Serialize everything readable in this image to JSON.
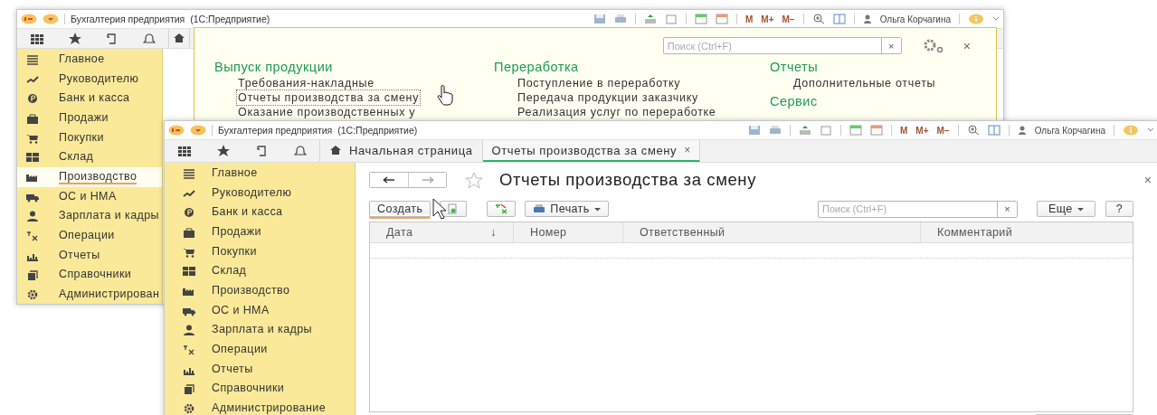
{
  "back_window": {
    "title": "Бухгалтерия предприятия",
    "app": "(1С:Предприятие)",
    "memory": [
      "M",
      "M+",
      "M−"
    ],
    "user": "Ольга Корчагина",
    "sidebar": [
      {
        "label": "Главное",
        "selected": false
      },
      {
        "label": "Руководителю",
        "selected": false
      },
      {
        "label": "Банк и касса",
        "selected": false
      },
      {
        "label": "Продажи",
        "selected": false
      },
      {
        "label": "Покупки",
        "selected": false
      },
      {
        "label": "Склад",
        "selected": false
      },
      {
        "label": "Производство",
        "selected": true
      },
      {
        "label": "ОС и НМА",
        "selected": false
      },
      {
        "label": "Зарплата и кадры",
        "selected": false
      },
      {
        "label": "Операции",
        "selected": false
      },
      {
        "label": "Отчеты",
        "selected": false
      },
      {
        "label": "Справочники",
        "selected": false
      },
      {
        "label": "Администрирован",
        "selected": false
      }
    ],
    "menu_panel": {
      "search": {
        "placeholder": "Поиск (Ctrl+F)"
      },
      "clear": "×",
      "close": "×",
      "columns": [
        {
          "sections": [
            {
              "title": "Выпуск продукции",
              "items": [
                {
                  "label": "Требования-накладные",
                  "focused": false
                },
                {
                  "label": "Отчеты производства за смену",
                  "focused": true
                },
                {
                  "label": "Оказание производственных у",
                  "focused": false
                }
              ]
            }
          ]
        },
        {
          "sections": [
            {
              "title": "Переработка",
              "items": [
                {
                  "label": "Поступление в переработку",
                  "focused": false
                },
                {
                  "label": "Передача продукции заказчику",
                  "focused": false
                },
                {
                  "label": "Реализация услуг по переработке",
                  "focused": false
                }
              ]
            }
          ]
        },
        {
          "sections": [
            {
              "title": "Отчеты",
              "items": [
                {
                  "label": "Дополнительные отчеты",
                  "focused": false
                }
              ]
            },
            {
              "title": "Сервис"
            }
          ]
        }
      ]
    }
  },
  "front_window": {
    "title": "Бухгалтерия предприятия",
    "app": "(1С:Предприятие)",
    "memory": [
      "M",
      "M+",
      "M−"
    ],
    "user": "Ольга Корчагина",
    "tabs": [
      {
        "kind": "home",
        "label": "Начальная страница",
        "selected": false
      },
      {
        "kind": "document",
        "label": "Отчеты производства за смену",
        "close": "×",
        "selected": true
      }
    ],
    "sidebar": [
      {
        "label": "Главное",
        "selected": false
      },
      {
        "label": "Руководителю",
        "selected": false
      },
      {
        "label": "Банк и касса",
        "selected": false
      },
      {
        "label": "Продажи",
        "selected": false
      },
      {
        "label": "Покупки",
        "selected": false
      },
      {
        "label": "Склад",
        "selected": false
      },
      {
        "label": "Производство",
        "selected": false
      },
      {
        "label": "ОС и НМА",
        "selected": false
      },
      {
        "label": "Зарплата и кадры",
        "selected": false
      },
      {
        "label": "Операции",
        "selected": false
      },
      {
        "label": "Отчеты",
        "selected": false
      },
      {
        "label": "Справочники",
        "selected": false
      },
      {
        "label": "Администрирование",
        "selected": false
      }
    ],
    "form": {
      "title": "Отчеты производства за смену",
      "close": "×",
      "create": "Создать",
      "print": "Печать",
      "search": {
        "placeholder": "Поиск (Ctrl+F)"
      },
      "clear": "×",
      "more": "Еще",
      "help": "?",
      "columns": [
        {
          "label": "Дата",
          "sort": "↓"
        },
        {
          "label": "Номер"
        },
        {
          "label": "Ответственный"
        },
        {
          "label": "Комментарий"
        }
      ]
    }
  }
}
